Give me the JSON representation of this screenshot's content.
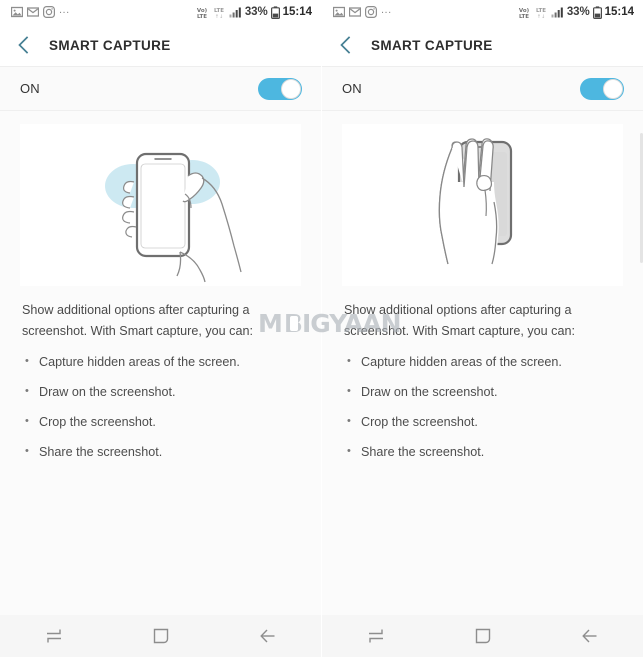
{
  "status_bar": {
    "notification_icons": [
      "gallery-icon",
      "gmail-icon",
      "instagram-icon"
    ],
    "overflow": "...",
    "volte": "VoLTE",
    "network": "LTE",
    "battery_percent": "33%",
    "clock": "15:14"
  },
  "app_bar": {
    "back_label": "back",
    "title": "SMART CAPTURE"
  },
  "toggle": {
    "label": "ON",
    "state": "on",
    "accent_color": "#4db7e0"
  },
  "illustration": {
    "left_alt": "hand-holding-phone-with-highlight",
    "right_alt": "palm-swipe-across-phone-screen"
  },
  "description": {
    "paragraph": "Show additional options after capturing a screenshot. With Smart capture, you can:",
    "bullets": [
      "Capture hidden areas of the screen.",
      "Draw on the screenshot.",
      "Crop the screenshot.",
      "Share the screenshot."
    ]
  },
  "nav_bar": {
    "recents_label": "Recents",
    "home_label": "Home",
    "back_label": "Back"
  },
  "watermark": {
    "prefix": "M",
    "suffix": "BIGYAAN"
  }
}
